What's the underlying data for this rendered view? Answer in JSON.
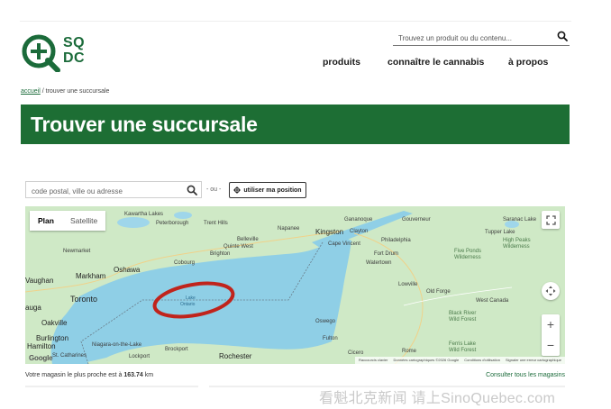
{
  "brand": {
    "line1": "SQ",
    "line2": "DC",
    "color": "#1b6b3a"
  },
  "header": {
    "search": {
      "placeholder": "Trouvez un produit ou du contenu...",
      "icon": "search-icon"
    },
    "nav": [
      "produits",
      "connaître le cannabis",
      "à propos"
    ]
  },
  "breadcrumb": {
    "home": "accueil",
    "separator": " / ",
    "current": "trouver une succursale"
  },
  "page_title": "Trouver une succursale",
  "locator": {
    "placeholder": "code postal, ville ou adresse",
    "separator": "- ou -",
    "position_button": "utiliser ma position",
    "position_icon": "crosshair-icon"
  },
  "map": {
    "tabs": {
      "plan": "Plan",
      "satellite": "Satellite"
    },
    "labels": {
      "kawartha": "Kawartha Lakes",
      "peterborough": "Peterborough",
      "trent": "Trent Hills",
      "napanee": "Napanee",
      "kingston": "Kingston",
      "gananoque": "Gananoque",
      "clayton": "Clayton",
      "gouverneur": "Gouverneur",
      "saranac": "Saranac Lake",
      "tupper": "Tupper Lake",
      "highpeaks": "High Peaks Wilderness",
      "newmarket": "Newmarket",
      "belleville": "Belleville",
      "quinte": "Quinte West",
      "brighton": "Brighton",
      "capevincent": "Cape Vincent",
      "philadelphia": "Philadelphia",
      "fortdrum": "Fort Drum",
      "watertown": "Watertown",
      "fiveponds": "Five Ponds Wilderness",
      "markham": "Markham",
      "oshawa": "Oshawa",
      "cobourg": "Cobourg",
      "vaughan": "Vaughan",
      "toronto": "Toronto",
      "lowville": "Lowville",
      "mississauga": "auga",
      "oldforge": "Old Forge",
      "westcanada": "West Canada",
      "lake1": "Lake",
      "lake2": "Ontario",
      "oakville": "Oakville",
      "blackriver": "Black River Wild Forest",
      "burlington": "Burlington",
      "hamilton": "Hamilton",
      "niagara": "Niagara-on-the-Lake",
      "oswego": "Oswego",
      "fulton": "Fulton",
      "ferris": "Ferris Lake Wild Forest",
      "brockport": "Brockport",
      "rome": "Rome",
      "lockport": "Lockport",
      "rochester": "Rochester",
      "cicero": "Cicero",
      "st_catharines": "St. Catharines"
    },
    "google": "Google",
    "attribution": [
      "Raccourcis clavier",
      "Données cartographiques ©2026 Google",
      "Conditions d'utilisation",
      "Signaler une erreur cartographique"
    ],
    "zoom_in": "+",
    "zoom_out": "−",
    "water_color": "#8fcfe6",
    "land_color": "#cfe9c6",
    "highlight_color": "#c0241c"
  },
  "results": {
    "nearest_prefix": "Votre magasin le plus proche est à ",
    "nearest_distance": "163.74",
    "nearest_unit": " km",
    "see_all": "Consulter tous les magasins"
  },
  "watermark": "看魁北克新闻 请上SinoQuebec.com"
}
